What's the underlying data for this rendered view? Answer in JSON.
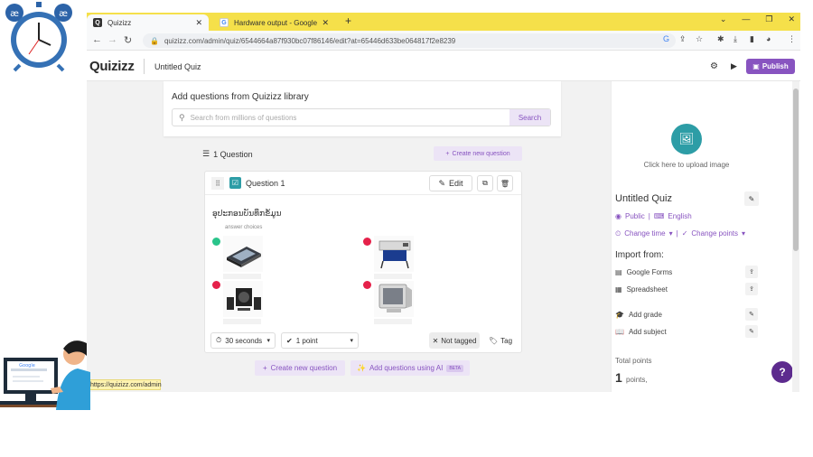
{
  "browser": {
    "tabs": [
      {
        "title": "Quizizz",
        "active": true
      },
      {
        "title": "Hardware output - Google Sear",
        "active": false
      }
    ],
    "new_tab_label": "+",
    "url": "quizizz.com/admin/quiz/6544664a87f930bc07f86146/edit?at=65446d633be064817f2e8239",
    "status_url": "https://quizizz.com/admin"
  },
  "header": {
    "logo": "Quizizz",
    "quiz_title": "Untitled Quiz",
    "publish_label": "Publish"
  },
  "library": {
    "title": "Add questions from Quizizz library",
    "search_placeholder": "Search from millions of questions",
    "search_button": "Search"
  },
  "questions_summary": {
    "count_label": "1 Question",
    "create_new_label": "Create new question"
  },
  "question": {
    "label": "Question 1",
    "edit_label": "Edit",
    "text": "ອຸປະກອນບັນທຶກຂໍ້ມູນ",
    "answer_choices_label": "answer choices",
    "choices": [
      {
        "icon": "flatbed-scanner-image",
        "correct": true
      },
      {
        "icon": "plotter-printer-image",
        "correct": false
      },
      {
        "icon": "speakers-image",
        "correct": false
      },
      {
        "icon": "crt-monitor-image",
        "correct": false
      }
    ],
    "time_label": "30 seconds",
    "points_label": "1 point",
    "tag_status": "Not tagged",
    "tag_label": "Tag"
  },
  "bottom_actions": {
    "create_new_label": "Create new question",
    "ai_label": "Add questions using AI",
    "beta_label": "BETA"
  },
  "right_panel": {
    "upload_text": "Click here to upload image",
    "quiz_title": "Untitled Quiz",
    "visibility": "Public",
    "language": "English",
    "change_time": "Change time",
    "change_points": "Change points",
    "import_heading": "Import from:",
    "import_items": [
      "Google Forms",
      "Spreadsheet"
    ],
    "add_grade": "Add grade",
    "add_subject": "Add subject",
    "total_points_label": "Total points",
    "total_points_value": "1",
    "total_points_unit": "points,"
  },
  "colors": {
    "brand_purple": "#8854c0",
    "teal": "#2d9da6",
    "correct": "#2ac48a",
    "wrong": "#e5214a",
    "tabbar_yellow": "#f5e04a"
  }
}
